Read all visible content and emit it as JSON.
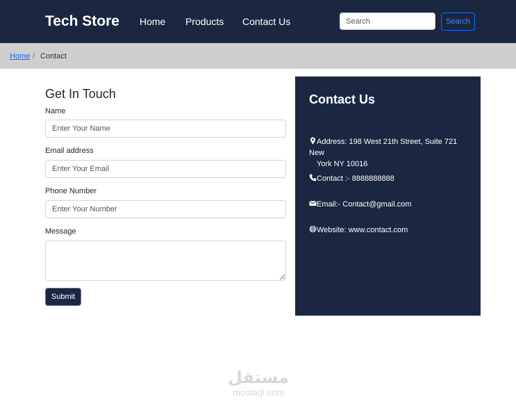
{
  "navbar": {
    "brand": "Tech Store",
    "links": [
      "Home",
      "Products",
      "Contact Us"
    ],
    "search_placeholder": "Search",
    "search_button": "Search"
  },
  "breadcrumb": {
    "home": "Home",
    "separator": "/",
    "current": "Contact"
  },
  "form": {
    "title": "Get In Touch",
    "name_label": "Name",
    "name_placeholder": "Enter Your Name",
    "email_label": "Email address",
    "email_placeholder": "Enter Your Email",
    "phone_label": "Phone Number",
    "phone_placeholder": "Enter Your Number",
    "message_label": "Message",
    "message_value": "",
    "submit_label": "Submit"
  },
  "contact_panel": {
    "title": "Contact Us",
    "address": "Address: 198 West 21th Street, Suite 721 New",
    "address_line2": "York NY 10016",
    "phone": "Contact :- 8888888888",
    "email": "Email:- Contact@gmail.com",
    "website": "Website: www.contact.com",
    "icons": [
      "map-pin-icon",
      "phone-icon",
      "envelope-icon",
      "globe-icon"
    ]
  },
  "watermark": {
    "arabic": "مستقل",
    "latin": "mostaql.com"
  },
  "colors": {
    "navy": "#1b2741",
    "breadcrumb_bg": "#cfcfcf",
    "link_blue": "#0d6efd"
  }
}
